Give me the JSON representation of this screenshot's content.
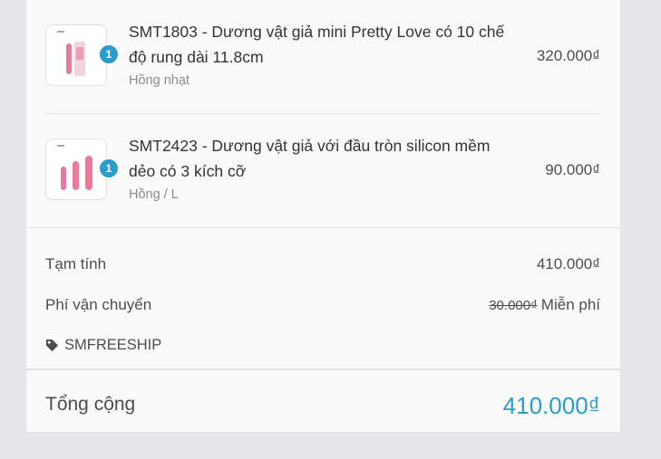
{
  "products": [
    {
      "quantity": "1",
      "name": "SMT1803 - Dương vật giả mini Pretty Love có 10 chế độ rung dài 11.8cm",
      "variant": "Hồng nhạt",
      "price": "320.000₫"
    },
    {
      "quantity": "1",
      "name": "SMT2423 - Dương vật giả với đầu tròn silicon mềm dẻo có 3 kích cỡ",
      "variant": "Hồng / L",
      "price": "90.000₫"
    }
  ],
  "summary": {
    "subtotal_label": "Tạm tính",
    "subtotal_value": "410.000₫",
    "shipping_label": "Phí vận chuyển",
    "shipping_original": "30.000₫",
    "shipping_value": "Miễn phí",
    "discount_code": "SMFREESHIP"
  },
  "total": {
    "label": "Tổng cộng",
    "value": "410.000₫"
  },
  "colors": {
    "accent": "#2a9dcc",
    "product_pink": "#e8799a",
    "panel_bg": "#fafafa",
    "page_bg": "#e6e7e9"
  },
  "icons": {
    "discount": "tag-icon"
  }
}
